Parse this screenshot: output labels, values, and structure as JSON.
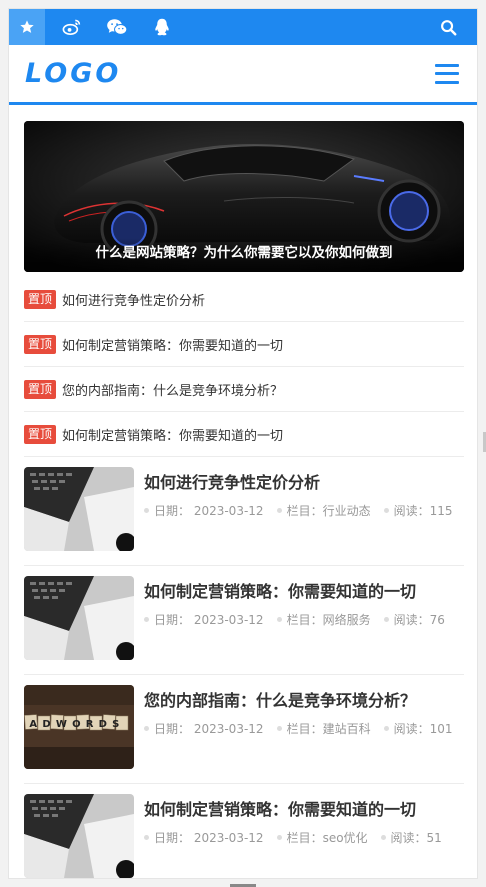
{
  "topbar": {
    "icons": [
      "star-icon",
      "weibo-icon",
      "wechat-icon",
      "qq-icon"
    ],
    "search_icon": "search-icon"
  },
  "header": {
    "logo": "LOGO",
    "menu_icon": "hamburger-menu-icon"
  },
  "banner": {
    "caption": "什么是网站策略？为什么你需要它以及你如何做到"
  },
  "pinned": {
    "badge": "置顶",
    "items": [
      {
        "title": "如何进行竞争性定价分析"
      },
      {
        "title": "如何制定营销策略：你需要知道的一切"
      },
      {
        "title": "您的内部指南：什么是竞争环境分析？"
      },
      {
        "title": "如何制定营销策略：你需要知道的一切"
      }
    ]
  },
  "articles": [
    {
      "title": "如何进行竞争性定价分析",
      "date": "日期： 2023-03-12",
      "column": "栏目：行业动态",
      "reads": "阅读：115",
      "thumb": "laptop"
    },
    {
      "title": "如何制定营销策略：你需要知道的一切",
      "date": "日期： 2023-03-12",
      "column": "栏目：网络服务",
      "reads": "阅读：76",
      "thumb": "laptop"
    },
    {
      "title": "您的内部指南：什么是竞争环境分析？",
      "date": "日期： 2023-03-12",
      "column": "栏目：建站百科",
      "reads": "阅读：101",
      "thumb": "adwords"
    },
    {
      "title": "如何制定营销策略：你需要知道的一切",
      "date": "日期： 2023-03-12",
      "column": "栏目：seo优化",
      "reads": "阅读：51",
      "thumb": "laptop"
    }
  ],
  "thumb_text": "ADWORDS",
  "colors": {
    "primary": "#1e88f0",
    "badge": "#e74c3c"
  }
}
